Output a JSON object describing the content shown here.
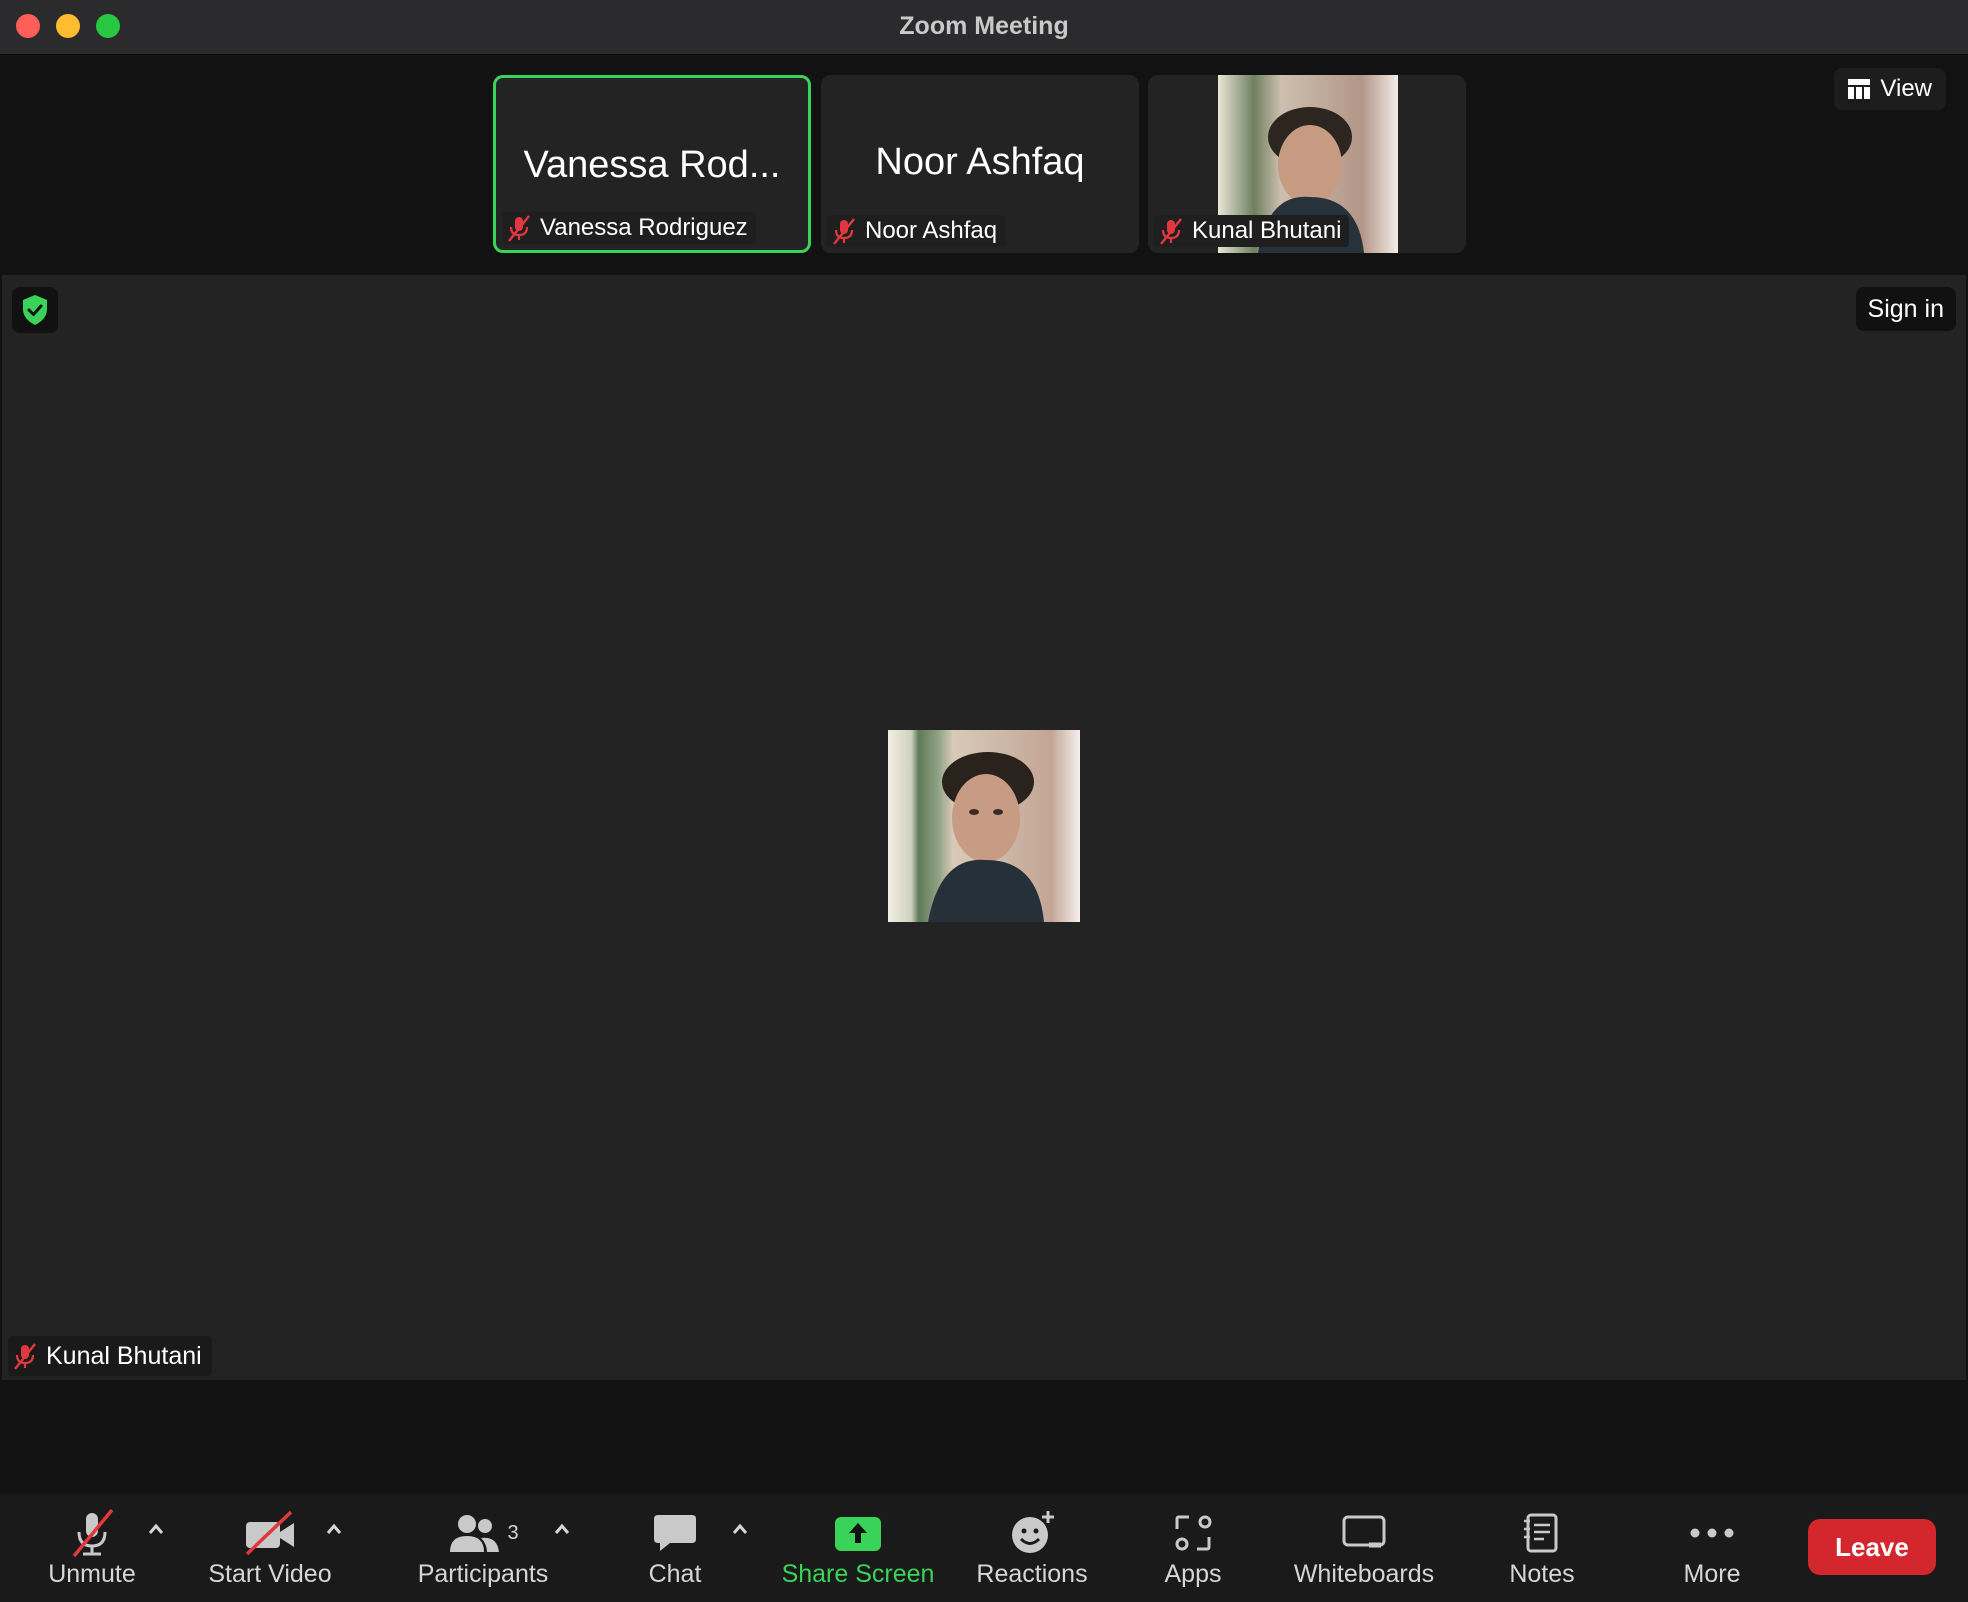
{
  "window": {
    "title": "Zoom Meeting"
  },
  "view_button": {
    "label": "View",
    "icon": "grid-view-icon"
  },
  "thumbnails": [
    {
      "display_name": "Vanessa Rod...",
      "name": "Vanessa Rodriguez",
      "active": true,
      "muted": true
    },
    {
      "display_name": "Noor Ashfaq",
      "name": "Noor Ashfaq",
      "active": false,
      "muted": true
    },
    {
      "name": "Kunal Bhutani",
      "active": false,
      "muted": true,
      "has_photo": true
    }
  ],
  "stage": {
    "sign_in_label": "Sign in",
    "speaker_name": "Kunal Bhutani",
    "security_icon": "shield-check-icon"
  },
  "toolbar": {
    "unmute": "Unmute",
    "start_video": "Start Video",
    "participants": "Participants",
    "participants_count": "3",
    "chat": "Chat",
    "share_screen": "Share Screen",
    "reactions": "Reactions",
    "apps": "Apps",
    "whiteboards": "Whiteboards",
    "notes": "Notes",
    "more": "More",
    "leave": "Leave"
  },
  "colors": {
    "accent_green": "#3ad35a",
    "leave_red": "#d3272d",
    "muted_red": "#e0383e"
  }
}
